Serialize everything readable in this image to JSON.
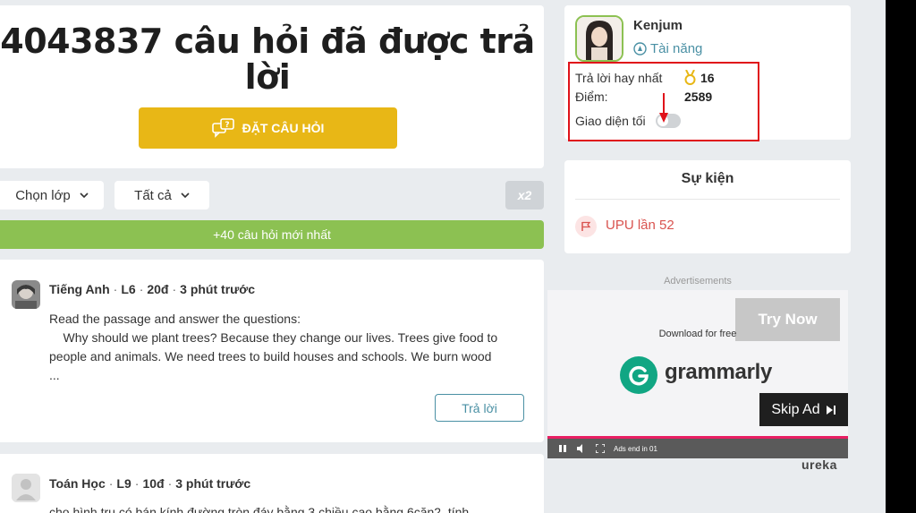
{
  "hero": {
    "title": "4043837 câu hỏi đã được trả lời",
    "ask_button": "ĐẶT CÂU HỎI"
  },
  "filters": {
    "class_select": "Chọn lớp",
    "scope_select": "Tất cả",
    "multiplier_badge": "x2"
  },
  "new_questions_bar": "+40 câu hỏi mới nhất",
  "questions": [
    {
      "subject": "Tiếng Anh",
      "grade": "L6",
      "points": "20đ",
      "time": "3 phút trước",
      "body_lines": [
        "Read the passage and answer the questions:",
        "    Why should we plant trees? Because they change our lives. Trees give food to",
        "people and animals. We need trees to build houses and schools. We burn wood",
        "..."
      ],
      "answer_button": "Trả lời"
    },
    {
      "subject": "Toán Học",
      "grade": "L9",
      "points": "10đ",
      "time": "3 phút trước",
      "body_lines": [
        "cho hình trụ có bán kính đường tròn đáy bằng 3 chiều cao bằng  6căn2. tính"
      ]
    }
  ],
  "user": {
    "name": "Kenjum",
    "rank": "Tài năng",
    "best_answers_label": "Trả lời hay nhất",
    "best_answers_value": "16",
    "points_label": "Điểm:",
    "points_value": "2589",
    "dark_mode_label": "Giao diện tối",
    "dark_mode_on": false
  },
  "events": {
    "title": "Sự kiện",
    "items": [
      {
        "label": "UPU lần 52"
      }
    ]
  },
  "ads": {
    "label": "Advertisements",
    "try_now": "Try Now",
    "download_text": "Download for free",
    "brand": "grammarly",
    "skip_ad": "Skip Ad",
    "ads_end": "Ads end in 01",
    "network": "ureka"
  },
  "colors": {
    "ask_button": "#e8b716",
    "new_bar": "#8cc152",
    "highlight_box": "#e0121a",
    "accent": "#4a90a4",
    "event_red": "#d9534f"
  }
}
